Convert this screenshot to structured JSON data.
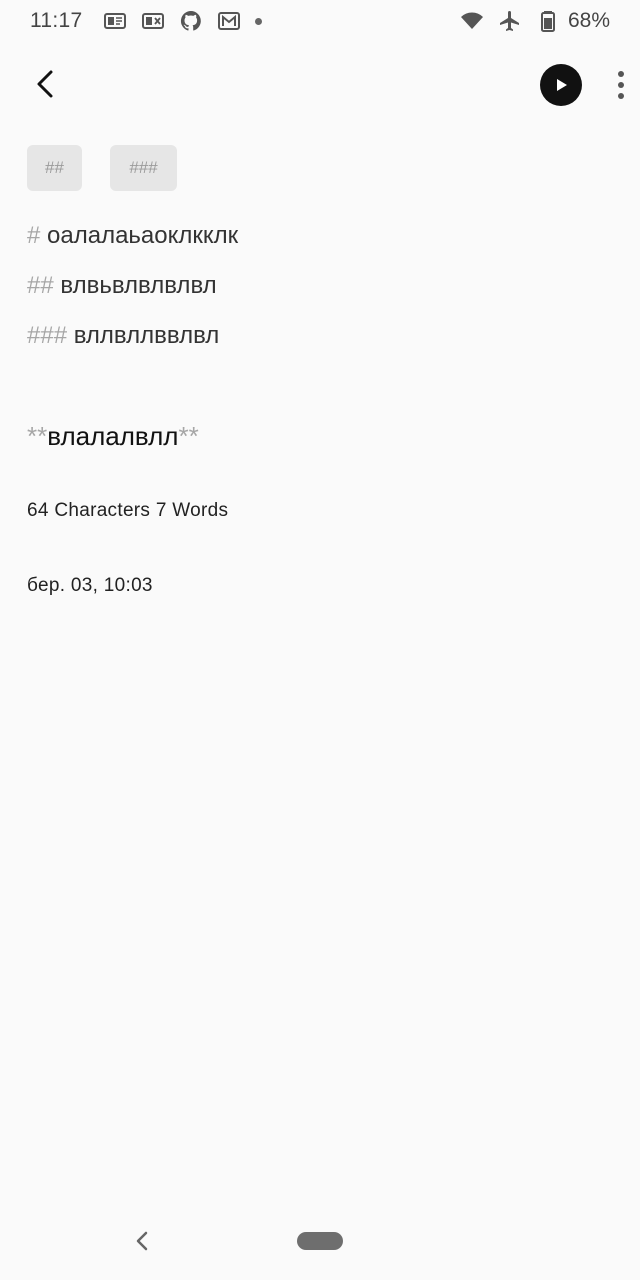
{
  "status_bar": {
    "time": "11:17",
    "battery_percent": "68%",
    "left_icons": [
      "notification-icon-1",
      "notification-icon-2",
      "github-icon",
      "gmail-icon",
      "dot-icon"
    ],
    "right_icons": [
      "wifi-icon",
      "airplane-icon",
      "battery-icon"
    ]
  },
  "toolbar": {
    "back_icon": "back-arrow-icon",
    "play_icon": "play-icon",
    "more_icon": "more-vert-icon"
  },
  "heading_chips": {
    "h2_label": "##",
    "h3_label": "###"
  },
  "editor": {
    "line1": {
      "marker": "#",
      "text": " оалалаьаоклкклк"
    },
    "line2": {
      "marker": "##",
      "text": " влвьвлвлвлвл"
    },
    "line3": {
      "marker": "###",
      "text": " вллвллввлвл"
    },
    "line4": {
      "marker_open": "**",
      "text": "влалалвлл",
      "marker_close": "**"
    }
  },
  "stats": {
    "counts": "64 Characters 7 Words",
    "date": "бер. 03, 10:03"
  },
  "colors": {
    "background": "#fafafa",
    "chip_bg": "#e6e6e6",
    "marker_gray": "#a6a6a6",
    "play_bg": "#111111"
  }
}
